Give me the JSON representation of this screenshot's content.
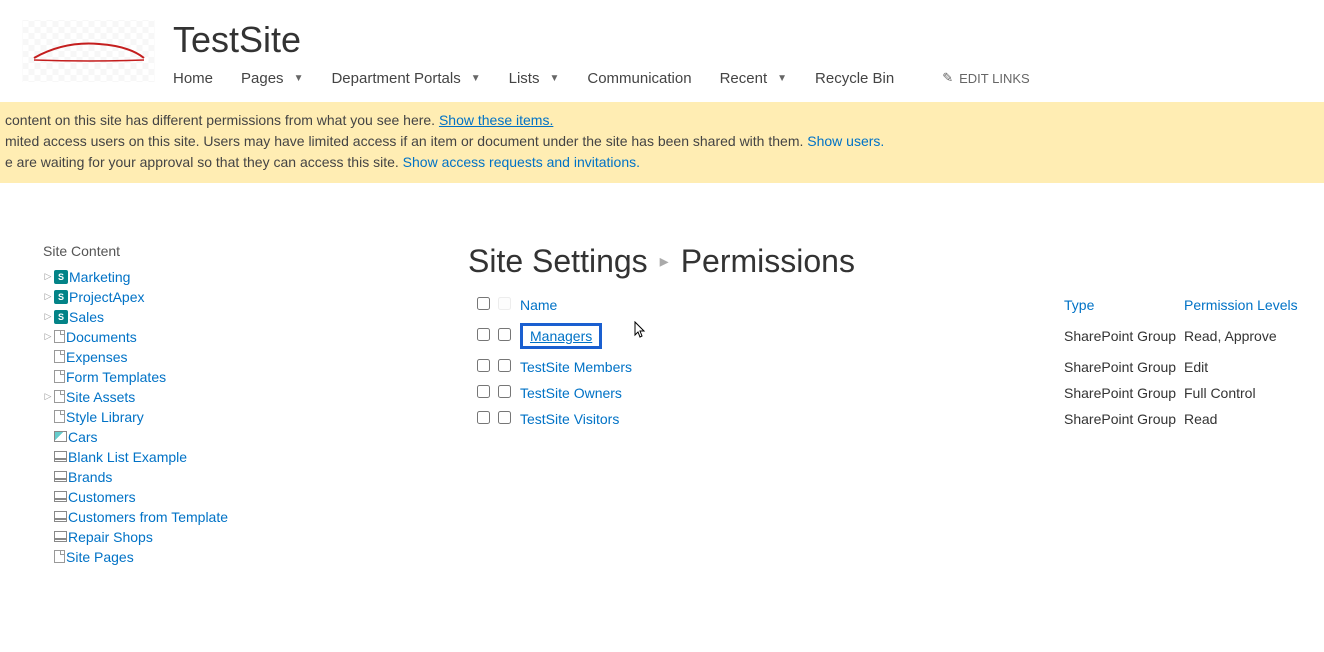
{
  "site": {
    "title": "TestSite"
  },
  "nav": {
    "items": [
      {
        "label": "Home",
        "dropdown": false
      },
      {
        "label": "Pages",
        "dropdown": true
      },
      {
        "label": "Department Portals",
        "dropdown": true
      },
      {
        "label": "Lists",
        "dropdown": true
      },
      {
        "label": "Communication",
        "dropdown": false
      },
      {
        "label": "Recent",
        "dropdown": true
      },
      {
        "label": "Recycle Bin",
        "dropdown": false
      }
    ],
    "edit_links": "EDIT LINKS"
  },
  "banner": {
    "line1_a": " content on this site has different permissions from what you see here.  ",
    "line1_link": "Show these items.",
    "line2_a": "mited access users on this site. Users may have limited access if an item or document under the site has been shared with them. ",
    "line2_link": "Show users.",
    "line3_a": "e are waiting for your approval so that they can access this site. ",
    "line3_link": "Show access requests and invitations."
  },
  "sidebar": {
    "title": "Site Content",
    "items": [
      {
        "label": "Marketing",
        "icon": "sp",
        "expandable": true
      },
      {
        "label": "ProjectApex",
        "icon": "sp",
        "expandable": true
      },
      {
        "label": "Sales",
        "icon": "sp",
        "expandable": true
      },
      {
        "label": "Documents",
        "icon": "doc",
        "expandable": true
      },
      {
        "label": "Expenses",
        "icon": "doc",
        "expandable": false
      },
      {
        "label": "Form Templates",
        "icon": "doc",
        "expandable": false
      },
      {
        "label": "Site Assets",
        "icon": "doc",
        "expandable": true
      },
      {
        "label": "Style Library",
        "icon": "doc",
        "expandable": false
      },
      {
        "label": "Cars",
        "icon": "img",
        "expandable": false
      },
      {
        "label": "Blank List Example",
        "icon": "list",
        "expandable": false
      },
      {
        "label": "Brands",
        "icon": "list",
        "expandable": false
      },
      {
        "label": "Customers",
        "icon": "list",
        "expandable": false
      },
      {
        "label": "Customers from Template",
        "icon": "list",
        "expandable": false
      },
      {
        "label": "Repair Shops",
        "icon": "list",
        "expandable": false
      },
      {
        "label": "Site Pages",
        "icon": "doc",
        "expandable": false
      }
    ]
  },
  "breadcrumb": {
    "parent": "Site Settings",
    "current": "Permissions"
  },
  "table": {
    "headers": {
      "name": "Name",
      "type": "Type",
      "level": "Permission Levels"
    },
    "rows": [
      {
        "name": "Managers",
        "type": "SharePoint Group",
        "level": "Read, Approve",
        "highlight": true
      },
      {
        "name": "TestSite Members",
        "type": "SharePoint Group",
        "level": "Edit",
        "highlight": false
      },
      {
        "name": "TestSite Owners",
        "type": "SharePoint Group",
        "level": "Full Control",
        "highlight": false
      },
      {
        "name": "TestSite Visitors",
        "type": "SharePoint Group",
        "level": "Read",
        "highlight": false
      }
    ]
  }
}
